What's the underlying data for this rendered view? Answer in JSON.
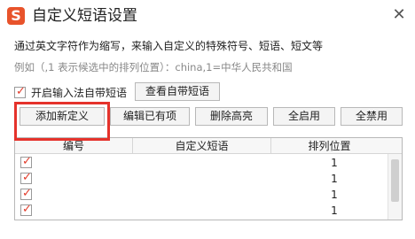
{
  "window": {
    "title": "自定义短语设置",
    "logo_letter": "S",
    "close_glyph": "✕"
  },
  "description": {
    "line1": "通过英文字符作为缩写，来输入自定义的特殊符号、短语、短文等",
    "line2": "例如（,1 表示候选中的排列位置）：china,1=中华人民共和国"
  },
  "enable_builtin": {
    "checked": true,
    "label": "开启输入法自带短语",
    "view_button": "查看自带短语"
  },
  "toolbar": {
    "add": "添加新定义",
    "edit": "编辑已有项",
    "delete_highlight": "删除高亮",
    "enable_all": "全启用",
    "disable_all": "全禁用"
  },
  "table": {
    "columns": [
      "编号",
      "自定义短语",
      "排列位置"
    ],
    "rows": [
      {
        "checked": true,
        "position": "1"
      },
      {
        "checked": true,
        "position": "1"
      },
      {
        "checked": true,
        "position": "1"
      },
      {
        "checked": true,
        "position": "1"
      }
    ]
  },
  "colors": {
    "logo": "#e8532b",
    "highlight": "#e5322b",
    "check": "#e23b2a"
  }
}
